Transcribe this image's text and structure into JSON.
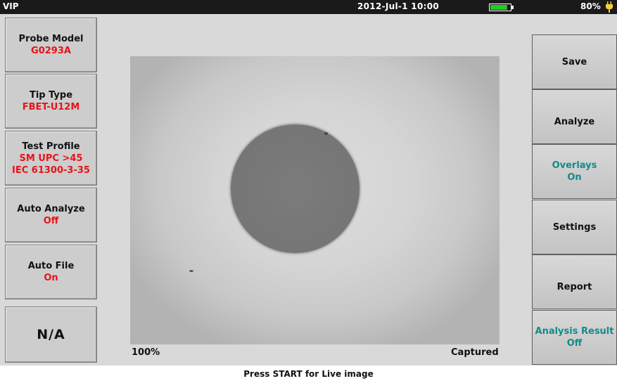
{
  "status_bar": {
    "title": "VIP",
    "datetime": "2012-Jul-1 10:00",
    "battery_percent": "80%",
    "battery_level": 0.85,
    "battery_color": "#22cc22"
  },
  "left_panel": [
    {
      "title": "Probe Model",
      "value": "G0293A"
    },
    {
      "title": "Tip Type",
      "value": "FBET-U12M"
    },
    {
      "title": "Test Profile",
      "value_line1": "SM UPC >45",
      "value_line2": "IEC 61300-3-35"
    },
    {
      "title": "Auto Analyze",
      "value": "Off"
    },
    {
      "title": "Auto File",
      "value": "On"
    },
    {
      "label": "N/A"
    }
  ],
  "right_panel": [
    {
      "label": "Save"
    },
    {
      "label": "Analyze"
    },
    {
      "label": "Overlays",
      "value": "On"
    },
    {
      "label": "Settings"
    },
    {
      "label": "Report"
    },
    {
      "label": "Analysis Result",
      "value": "Off"
    }
  ],
  "viewer": {
    "zoom": "100%",
    "status": "Captured"
  },
  "footer": {
    "hint": "Press START for Live image"
  },
  "colors": {
    "value_red": "#e8121b",
    "toggle_teal": "#0f8c8c"
  },
  "icons": [
    "battery-icon",
    "power-plug-icon"
  ]
}
